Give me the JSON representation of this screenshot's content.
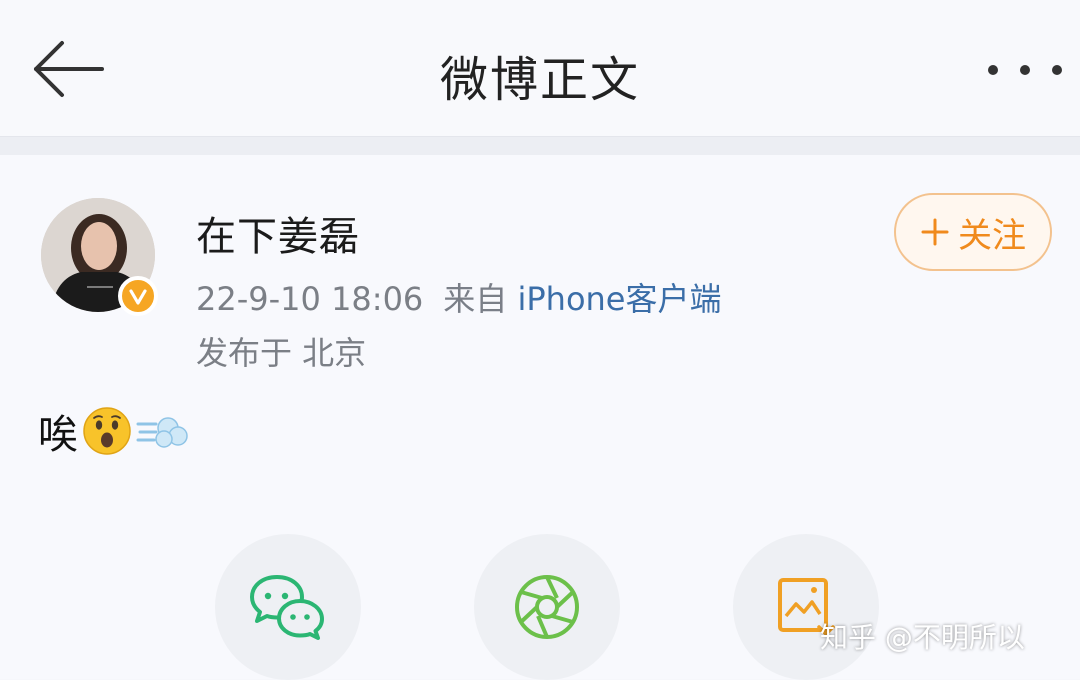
{
  "header": {
    "title": "微博正文",
    "back_icon": "arrow-left-icon",
    "more_icon": "more-dots-icon"
  },
  "post": {
    "author": "在下姜磊",
    "verified": true,
    "time": "22-9-10 18:06",
    "source_prefix": "来自",
    "source_client": "iPhone客户端",
    "location": "发布于 北京",
    "text": "唉",
    "emojis": [
      "astonished-face-emoji",
      "dash-emoji"
    ]
  },
  "follow_button": {
    "label": "关注",
    "icon": "plus-icon"
  },
  "share_options": [
    {
      "icon": "wechat-icon"
    },
    {
      "icon": "moments-icon"
    },
    {
      "icon": "save-image-icon"
    }
  ],
  "watermark": "知乎 @不明所以",
  "colors": {
    "accent_orange": "#f08a1c",
    "verified_gold": "#f6a623",
    "wechat_green": "#2bb673",
    "moments_green": "#6cc04a",
    "link_blue": "#3b6ea8"
  }
}
